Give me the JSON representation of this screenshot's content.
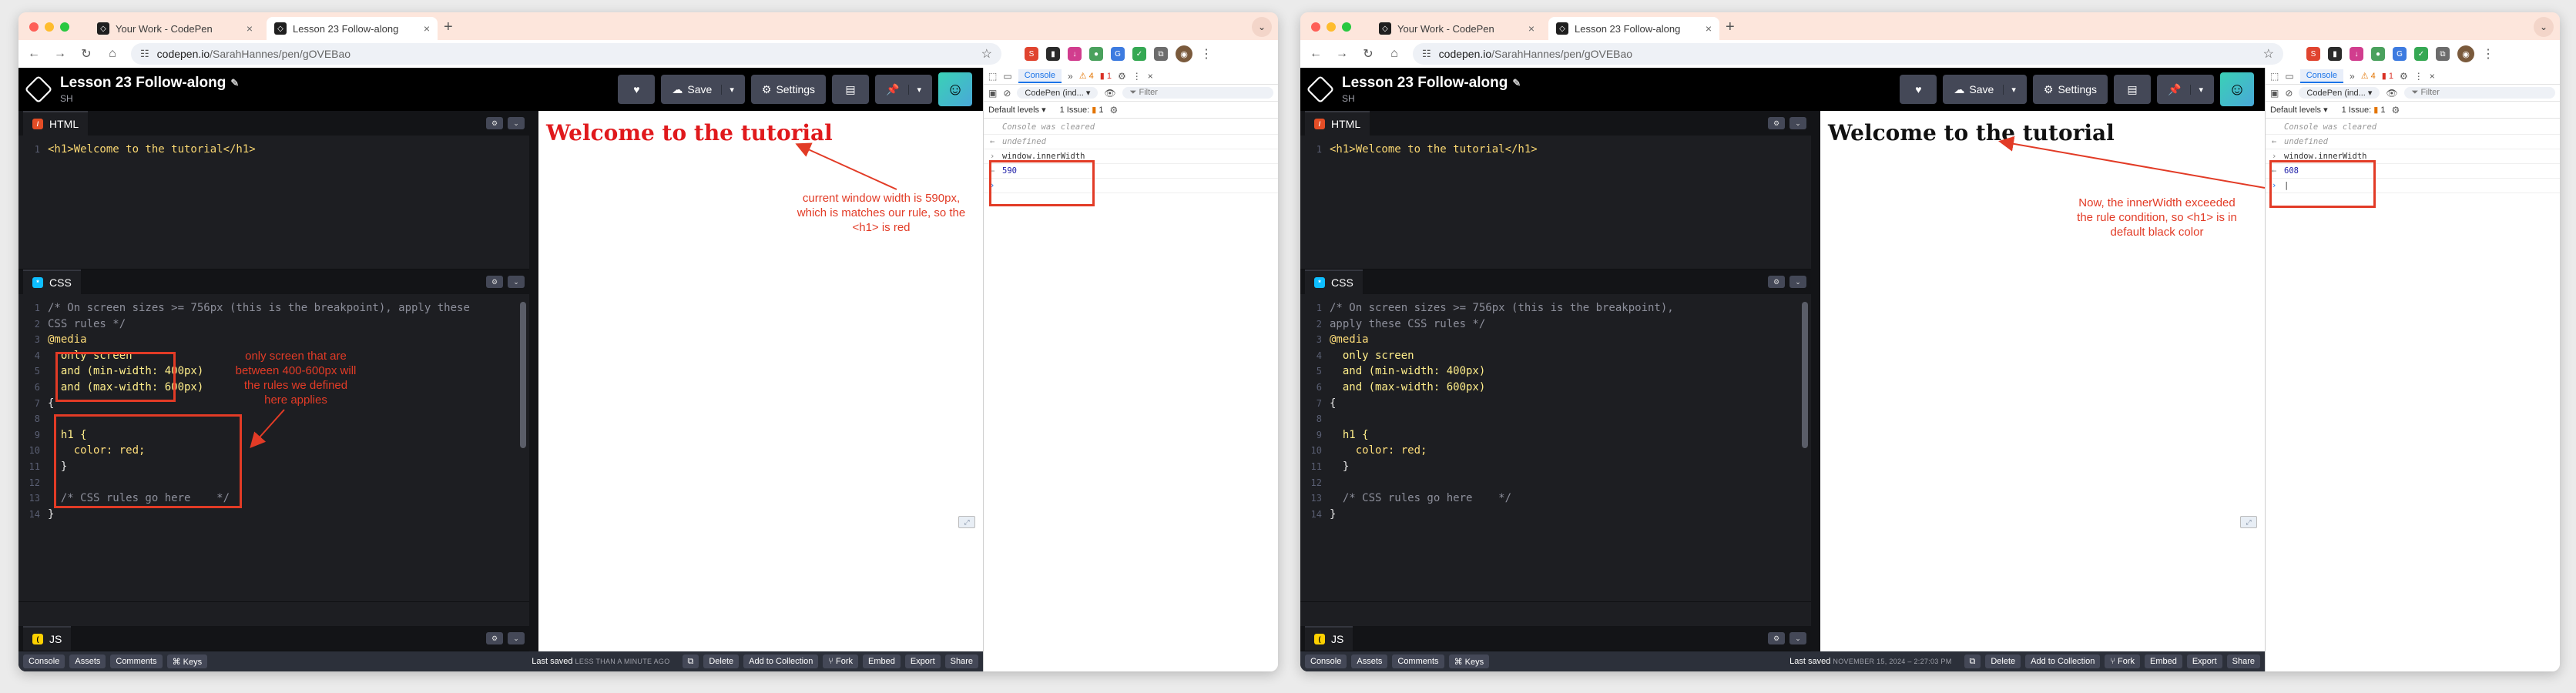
{
  "windows": [
    {
      "id": "w1",
      "tabs": [
        {
          "label": "Your Work - CodePen",
          "active": false
        },
        {
          "label": "Lesson 23 Follow-along",
          "active": true
        }
      ],
      "url": {
        "host": "codepen.io",
        "path": "/SarahHannes/pen/gOVEBao"
      },
      "pen": {
        "title": "Lesson 23 Follow-along",
        "user": "SH"
      },
      "header_buttons": {
        "save": "Save",
        "settings": "Settings"
      },
      "editors": {
        "html": {
          "label": "HTML",
          "lines": [
            "<h1>Welcome to the tutorial</h1>"
          ]
        },
        "css": {
          "label": "CSS",
          "lines": [
            "/* On screen sizes >= 756px (this is the breakpoint), apply these",
            "CSS rules */",
            "@media",
            "  only screen",
            "  and (min-width: 400px)",
            "  and (max-width: 600px)",
            "{",
            "",
            "  h1 {",
            "    color: red;",
            "  }",
            "",
            "  /* CSS rules go here    */",
            "}"
          ]
        },
        "js": {
          "label": "JS"
        }
      },
      "preview_heading": "Welcome to the tutorial",
      "bottom_bar": {
        "left": [
          "Console",
          "Assets",
          "Comments",
          "⌘ Keys"
        ],
        "saved_label": "Last saved",
        "saved_time": "LESS THAN A MINUTE AGO",
        "right": [
          "Delete",
          "Add to Collection",
          "Fork",
          "Embed",
          "Export",
          "Share"
        ]
      },
      "devtools": {
        "tab": "Console",
        "warnings": "4",
        "errors": "1",
        "context": "CodePen (ind...",
        "filter_placeholder": "Filter",
        "levels": "Default levels",
        "issues": "1 Issue:",
        "issue_count": "1",
        "console_lines": [
          "Console was cleared",
          "undefined",
          "window.innerWidth",
          "590"
        ]
      },
      "annotations": {
        "css_note": "only screen that are between 400-600px will the rules we defined here applies",
        "preview_note": "current window width is 590px, which is matches our rule, so the <h1> is red"
      },
      "heading_color": "#e0191c"
    },
    {
      "id": "w2",
      "tabs": [
        {
          "label": "Your Work - CodePen",
          "active": false
        },
        {
          "label": "Lesson 23 Follow-along",
          "active": true
        }
      ],
      "url": {
        "host": "codepen.io",
        "path": "/SarahHannes/pen/gOVEBao"
      },
      "pen": {
        "title": "Lesson 23 Follow-along",
        "user": "SH"
      },
      "header_buttons": {
        "save": "Save",
        "settings": "Settings"
      },
      "editors": {
        "html": {
          "label": "HTML",
          "lines": [
            "<h1>Welcome to the tutorial</h1>"
          ]
        },
        "css": {
          "label": "CSS",
          "lines": [
            "/* On screen sizes >= 756px (this is the breakpoint),",
            "apply these CSS rules */",
            "@media",
            "  only screen",
            "  and (min-width: 400px)",
            "  and (max-width: 600px)",
            "{",
            "",
            "  h1 {",
            "    color: red;",
            "  }",
            "",
            "  /* CSS rules go here    */",
            "}"
          ]
        },
        "js": {
          "label": "JS"
        }
      },
      "preview_heading": "Welcome to the tutorial",
      "bottom_bar": {
        "left": [
          "Console",
          "Assets",
          "Comments",
          "⌘ Keys"
        ],
        "saved_label": "Last saved",
        "saved_time": "NOVEMBER 15, 2024 – 2:27:03 PM",
        "right": [
          "Delete",
          "Add to Collection",
          "Fork",
          "Embed",
          "Export",
          "Share"
        ]
      },
      "devtools": {
        "tab": "Console",
        "warnings": "4",
        "errors": "1",
        "context": "CodePen (ind...",
        "filter_placeholder": "Filter",
        "levels": "Default levels",
        "issues": "1 Issue:",
        "issue_count": "1",
        "console_lines": [
          "Console was cleared",
          "undefined",
          "window.innerWidth",
          "608"
        ]
      },
      "annotations": {
        "preview_note": "Now, the innerWidth exceeded the rule condition, so <h1> is in default black color"
      },
      "heading_color": "#111111"
    }
  ],
  "colors": {
    "annotation": "#e23b26",
    "accent": "#1a73e8"
  },
  "icons": [
    "codepen-logo-icon",
    "heart-icon",
    "cloud-icon",
    "gear-icon",
    "layout-icon",
    "pin-icon",
    "chevron-down-icon",
    "close-icon",
    "search-icon",
    "star-icon"
  ]
}
